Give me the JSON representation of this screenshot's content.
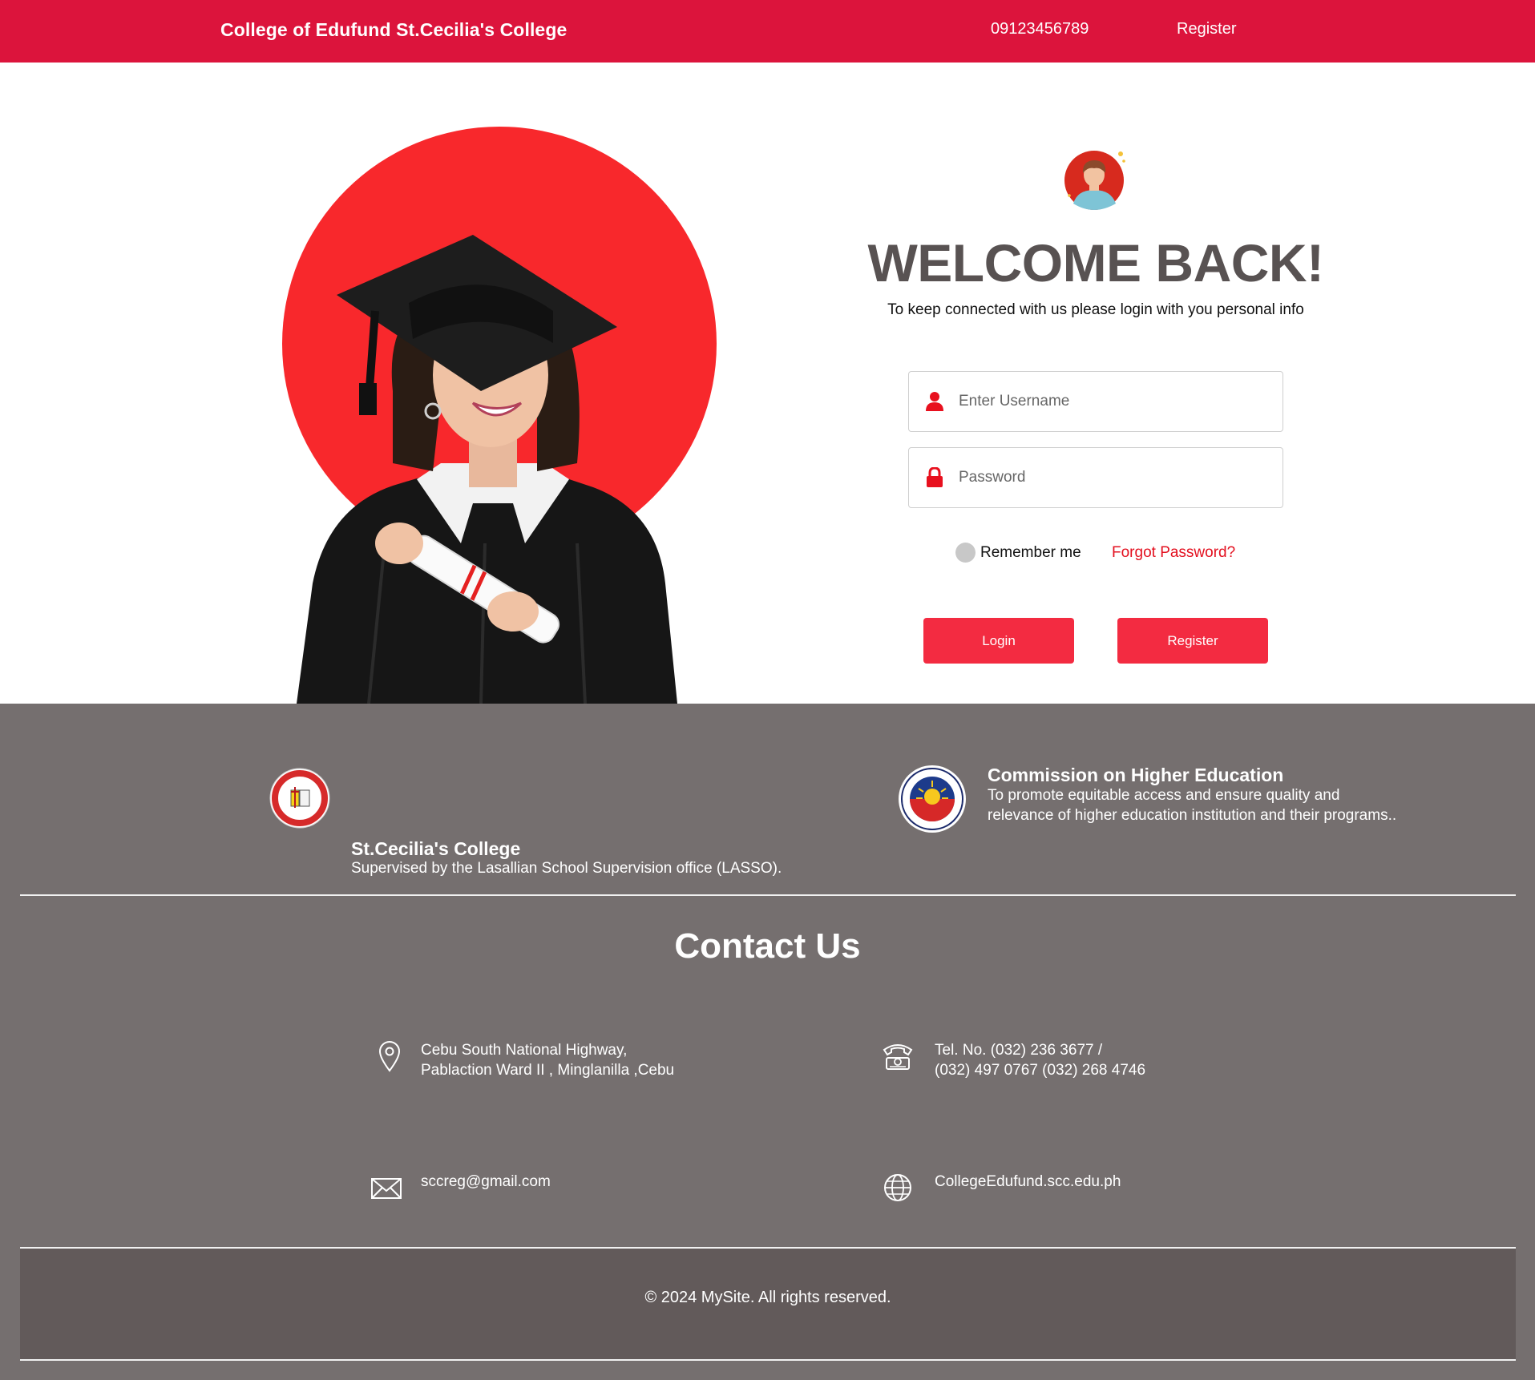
{
  "header": {
    "brand": "College of Edufund St.Cecilia's College",
    "phone": "09123456789",
    "register_link": "Register"
  },
  "login": {
    "title": "WELCOME BACK!",
    "subtitle": "To keep connected with us please login with you personal info",
    "username_placeholder": "Enter Username",
    "password_placeholder": "Password",
    "remember_label": "Remember me",
    "forgot_label": "Forgot Password?",
    "login_button": "Login",
    "register_button": "Register"
  },
  "footer": {
    "orgs": [
      {
        "name": "St.Cecilia's College",
        "desc_lines": [
          "Supervised by the Lasallian School Supervision office (LASSO)."
        ],
        "logo_text": "ST. CECILIA'S COLLEGE · CEBU, INC ·",
        "logo_year": "1999"
      },
      {
        "name": "Commission on Higher Education",
        "desc_lines": [
          "To promote equitable access and ensure quality and",
          "relevance of higher education institution and their programs.."
        ],
        "logo_text": "COMMISSION ON HIGHER EDUCATION",
        "logo_year": "1994"
      }
    ],
    "contact_title": "Contact Us",
    "contacts": {
      "address": [
        "Cebu South National Highway,",
        "Pablaction Ward II , Minglanilla ,Cebu"
      ],
      "phone": [
        "Tel. No. (032) 236 3677 /",
        "(032) 497 0767 (032) 268 4746"
      ],
      "email": "sccreg@gmail.com",
      "website": "CollegeEdufund.scc.edu.ph"
    },
    "copyright": "© 2024 MySite. All rights reserved."
  },
  "colors": {
    "topbar": "#dc143c",
    "accent_red": "#f32b41",
    "hero_circle": "#f8282c",
    "footer_bg": "#756f6f",
    "copyright_bg": "#625a5a",
    "title_gray": "#585252"
  },
  "icons": {
    "user": "user-icon",
    "lock": "lock-icon",
    "location": "location-pin-icon",
    "telephone": "telephone-icon",
    "email": "envelope-icon",
    "website": "globe-icon"
  }
}
